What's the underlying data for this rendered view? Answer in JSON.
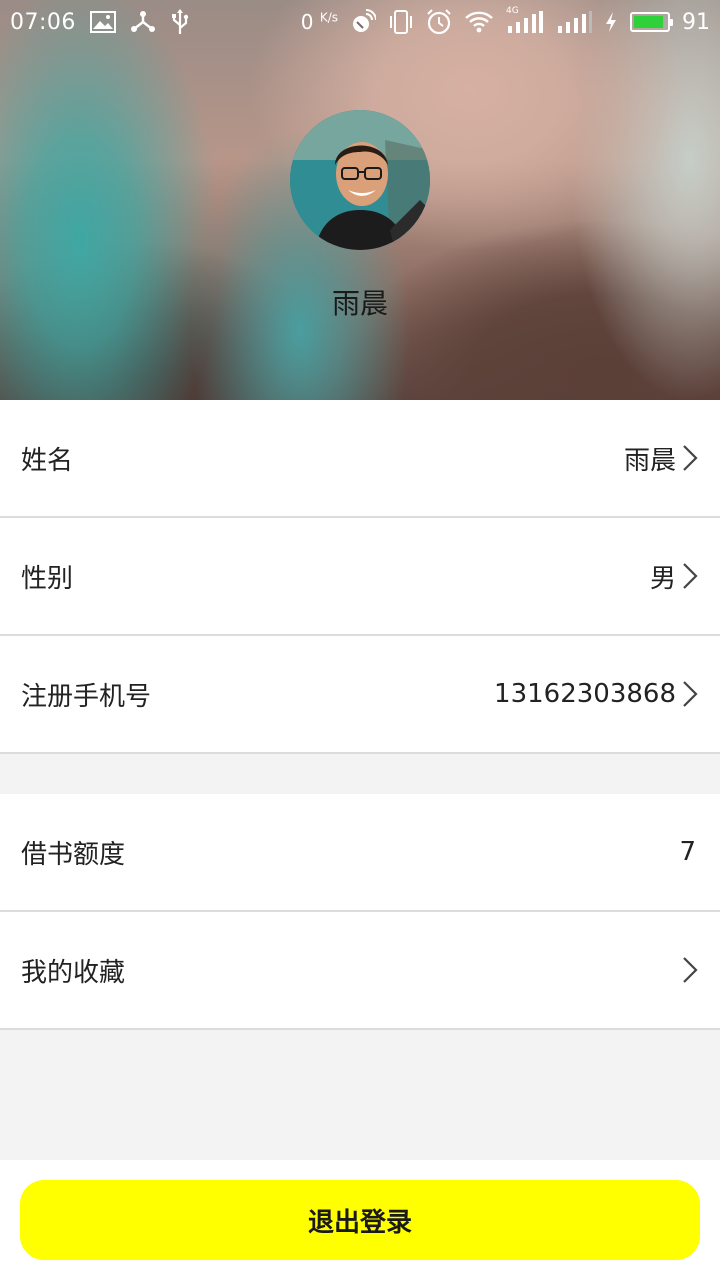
{
  "status_bar": {
    "time": "07:06",
    "net_speed": "0",
    "net_speed_unit": "K/s",
    "network_label": "4G",
    "battery_level": "91",
    "battery_color": "#2fd13b",
    "icons": [
      "image-icon",
      "share-icon",
      "usb-icon",
      "satellite-icon",
      "vibrate-icon",
      "alarm-icon",
      "wifi-icon",
      "signal-icon",
      "signal-icon",
      "charging-icon",
      "battery-icon"
    ]
  },
  "profile": {
    "name": "雨晨"
  },
  "info_rows": [
    {
      "label": "姓名",
      "value": "雨晨"
    },
    {
      "label": "性别",
      "value": "男"
    },
    {
      "label": "注册手机号",
      "value": "13162303868"
    }
  ],
  "account_rows": [
    {
      "label": "借书额度",
      "value": "7"
    },
    {
      "label": "我的收藏",
      "value": ""
    }
  ],
  "footer": {
    "logout_label": "退出登录",
    "button_color": "#ffff00"
  }
}
